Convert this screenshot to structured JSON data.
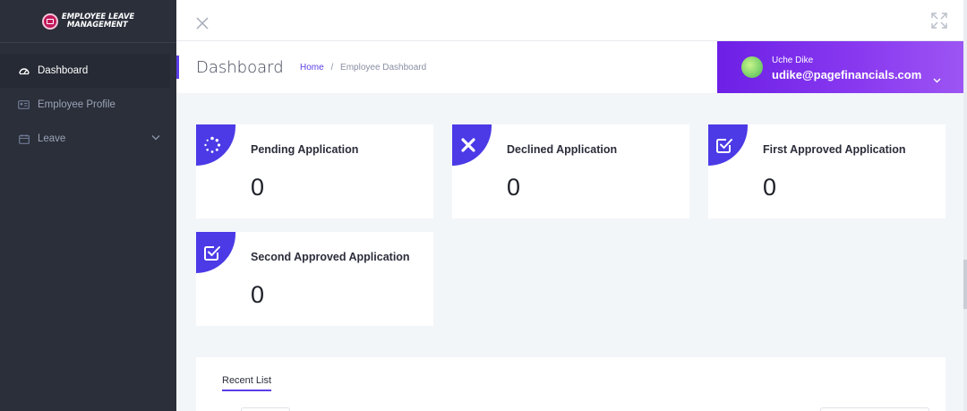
{
  "app": {
    "logo_line1": "Employee Leave",
    "logo_line2": "Management"
  },
  "sidebar": {
    "items": [
      {
        "label": "Dashboard",
        "icon": "dashboard-icon",
        "active": true
      },
      {
        "label": "Employee Profile",
        "icon": "id-card-icon",
        "active": false
      },
      {
        "label": "Leave",
        "icon": "calendar-icon",
        "active": false
      }
    ]
  },
  "subheader": {
    "title": "Dashboard",
    "breadcrumb_home": "Home",
    "breadcrumb_separator": "/",
    "breadcrumb_current": "Employee Dashboard"
  },
  "user": {
    "name": "Uche Dike",
    "email": "udike@pagefinancials.com"
  },
  "cards": [
    {
      "label": "Pending Application",
      "value": "0",
      "icon": "spinner-icon"
    },
    {
      "label": "Declined Application",
      "value": "0",
      "icon": "x-mark-icon"
    },
    {
      "label": "First Approved Application",
      "value": "0",
      "icon": "check-square-icon"
    },
    {
      "label": "Second Approved Application",
      "value": "0",
      "icon": "check-square-icon"
    }
  ],
  "recent": {
    "tab_label": "Recent List"
  },
  "colors": {
    "accent": "#4b3ae6",
    "sidebar_bg": "#2b2f3a",
    "user_gradient_start": "#6d1fe6",
    "user_gradient_end": "#9d55f3"
  }
}
